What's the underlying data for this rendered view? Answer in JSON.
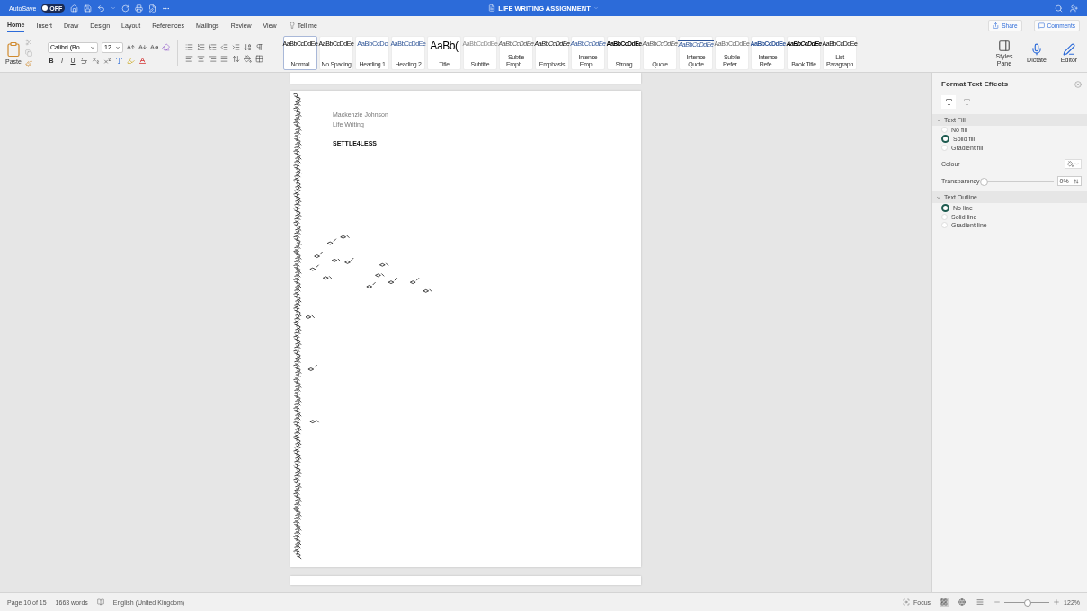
{
  "title_bar": {
    "autosave_label": "AutoSave",
    "autosave": {
      "on": false,
      "label": "OFF"
    },
    "title": "LIFE WRITING ASSIGNMENT"
  },
  "tabs": [
    {
      "label": "Home",
      "selected": true
    },
    {
      "label": "Insert",
      "selected": false
    },
    {
      "label": "Draw",
      "selected": false
    },
    {
      "label": "Design",
      "selected": false
    },
    {
      "label": "Layout",
      "selected": false
    },
    {
      "label": "References",
      "selected": false
    },
    {
      "label": "Mailings",
      "selected": false
    },
    {
      "label": "Review",
      "selected": false
    },
    {
      "label": "View",
      "selected": false
    }
  ],
  "tell_me": "Tell me",
  "share": "Share",
  "comments": "Comments",
  "ribbon": {
    "paste": "Paste",
    "font": "Calibri (Bo...",
    "size": "12",
    "bold": "B",
    "italic": "I",
    "underline": "U",
    "styles": [
      {
        "sample": "AaBbCcDdEe",
        "label": "Normal",
        "kind": "normal",
        "selected": true
      },
      {
        "sample": "AaBbCcDdEe",
        "label": "No Spacing",
        "kind": "plain",
        "selected": false
      },
      {
        "sample": "AaBbCcDc",
        "label": "Heading 1",
        "kind": "heading1",
        "selected": false
      },
      {
        "sample": "AaBbCcDdEe",
        "label": "Heading 2",
        "kind": "heading2",
        "selected": false
      },
      {
        "sample": "AaBb(",
        "label": "Title",
        "kind": "title",
        "selected": false
      },
      {
        "sample": "AaBbCcDdEe",
        "label": "Subtitle",
        "kind": "subtitle",
        "selected": false
      },
      {
        "sample": "AaBbCcDdEe",
        "label": "Subtle Emph...",
        "kind": "subtle",
        "selected": false
      },
      {
        "sample": "AaBbCcDdEe",
        "label": "Emphasis",
        "kind": "emphasis",
        "selected": false
      },
      {
        "sample": "AaBbCcDdEe",
        "label": "Intense Emp...",
        "kind": "intense",
        "selected": false
      },
      {
        "sample": "AaBbCcDdEe",
        "label": "Strong",
        "kind": "strong",
        "selected": false
      },
      {
        "sample": "AaBbCcDdEe",
        "label": "Quote",
        "kind": "quote",
        "selected": false
      },
      {
        "sample": "AaBbCcDdEe",
        "label": "Intense Quote",
        "kind": "intensequote",
        "selected": false
      },
      {
        "sample": "AaBbCcDdEe",
        "label": "Subtle Refer...",
        "kind": "subtleref",
        "selected": false
      },
      {
        "sample": "AaBbCcDdEe",
        "label": "Intense Refe...",
        "kind": "intenseref",
        "selected": false
      },
      {
        "sample": "AaBbCcDdEe",
        "label": "Book Title",
        "kind": "booktitle",
        "selected": false
      },
      {
        "sample": "AaBbCcDdEe",
        "label": "List Paragraph",
        "kind": "plain",
        "selected": false
      }
    ],
    "styles_pane": "Styles Pane",
    "dictate": "Dictate",
    "editor": "Editor"
  },
  "document": {
    "lines": [
      "Mackenzie Johnson",
      "Life Writing"
    ],
    "heading": "SETTLE4LESS"
  },
  "pane": {
    "title": "Format Text Effects",
    "sections": [
      {
        "title": "Text Fill",
        "expanded": true,
        "options": [
          {
            "label": "No fill",
            "selected": false
          },
          {
            "label": "Solid fill",
            "selected": true
          },
          {
            "label": "Gradient fill",
            "selected": false
          }
        ]
      },
      {
        "title": "Text Outline",
        "expanded": true,
        "options": [
          {
            "label": "No line",
            "selected": true
          },
          {
            "label": "Solid line",
            "selected": false
          },
          {
            "label": "Gradient line",
            "selected": false
          }
        ]
      }
    ],
    "colour_label": "Colour",
    "transparency_label": "Transparency",
    "transparency": {
      "level": 0,
      "value": "0%"
    }
  },
  "status_bar": {
    "page": "Page 10 of 15",
    "words": "1663 words",
    "language": "English (United Kingdom)",
    "focus": "Focus",
    "zoom": {
      "level": 0.5,
      "value": "122%"
    }
  }
}
